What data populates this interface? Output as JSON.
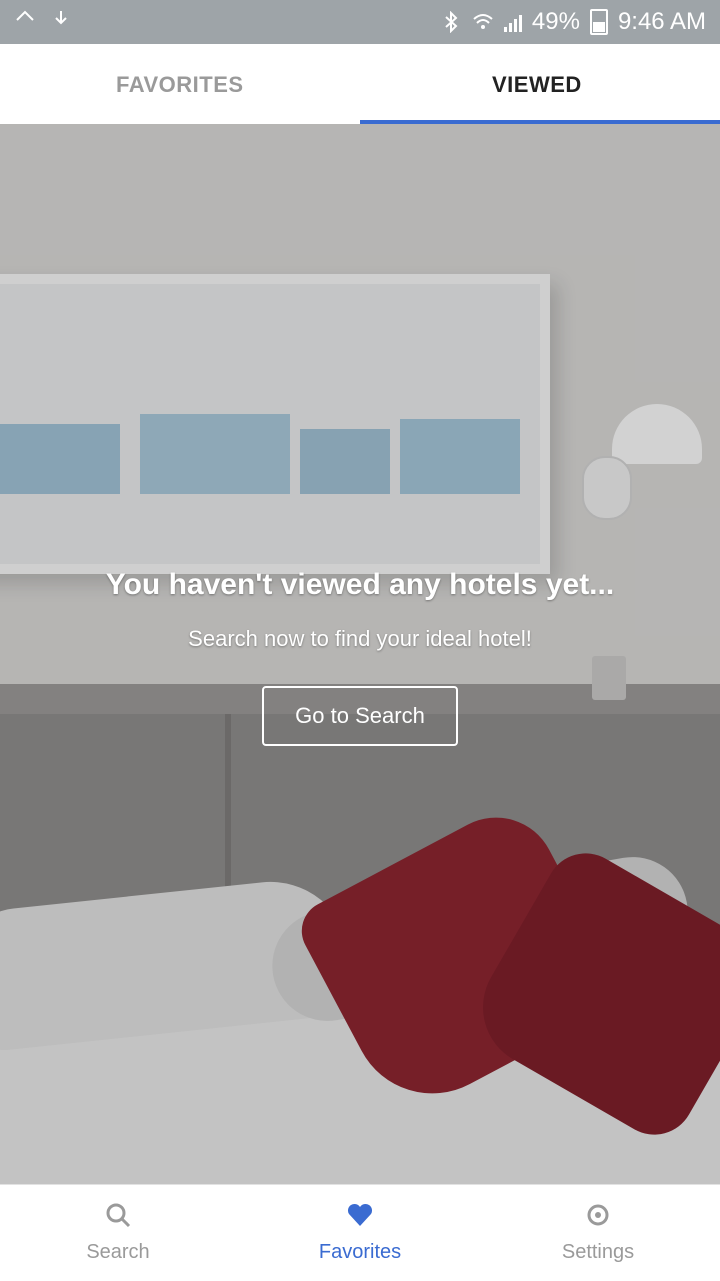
{
  "status_bar": {
    "battery": "49%",
    "time": "9:46 AM",
    "icons": [
      "bluetooth-icon",
      "wifi-icon",
      "signal-icon",
      "battery-icon"
    ]
  },
  "tabs": {
    "favorites_label": "FAVORITES",
    "viewed_label": "VIEWED",
    "active": "VIEWED",
    "accent_color": "#3a6bd1"
  },
  "empty_state": {
    "title": "You haven't viewed any hotels yet...",
    "subtitle": "Search now to find your ideal hotel!",
    "button_label": "Go to Search"
  },
  "bottom_nav": {
    "items": [
      {
        "label": "Search",
        "icon": "search-icon"
      },
      {
        "label": "Favorites",
        "icon": "heart-icon"
      },
      {
        "label": "Settings",
        "icon": "gear-icon"
      }
    ],
    "active": "Favorites"
  }
}
